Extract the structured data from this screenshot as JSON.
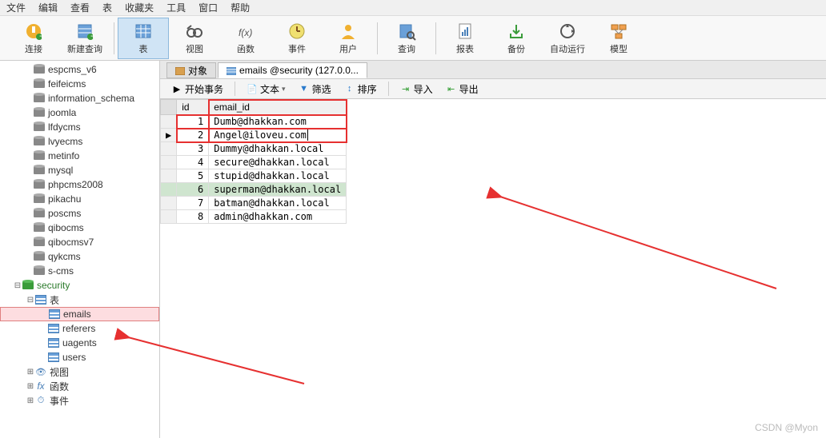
{
  "menu": {
    "items": [
      "文件",
      "编辑",
      "查看",
      "表",
      "收藏夹",
      "工具",
      "窗口",
      "帮助"
    ]
  },
  "toolbar": {
    "items": [
      {
        "label": "连接",
        "name": "connect-button",
        "icon": "plug",
        "dd": true
      },
      {
        "label": "新建查询",
        "name": "new-query-button",
        "icon": "query",
        "dd": false
      },
      {
        "label": "表",
        "name": "table-button",
        "icon": "table",
        "dd": true,
        "active": true
      },
      {
        "label": "视图",
        "name": "view-button",
        "icon": "view",
        "dd": false
      },
      {
        "label": "函数",
        "name": "function-button",
        "icon": "fx",
        "dd": false
      },
      {
        "label": "事件",
        "name": "event-button",
        "icon": "clock",
        "dd": false
      },
      {
        "label": "用户",
        "name": "user-button",
        "icon": "user",
        "dd": false
      },
      {
        "label": "查询",
        "name": "query2-button",
        "icon": "search",
        "dd": false
      },
      {
        "label": "报表",
        "name": "report-button",
        "icon": "report",
        "dd": false
      },
      {
        "label": "备份",
        "name": "backup-button",
        "icon": "backup",
        "dd": false
      },
      {
        "label": "自动运行",
        "name": "auto-run-button",
        "icon": "auto",
        "dd": false
      },
      {
        "label": "模型",
        "name": "model-button",
        "icon": "model",
        "dd": false
      }
    ]
  },
  "tree": {
    "databases": [
      "espcms_v6",
      "feifeicms",
      "information_schema",
      "joomla",
      "lfdycms",
      "lvyecms",
      "metinfo",
      "mysql",
      "phpcms2008",
      "pikachu",
      "poscms",
      "qibocms",
      "qibocmsv7",
      "qykcms",
      "s-cms"
    ],
    "active_db": "security",
    "groups": {
      "tables": {
        "label": "表",
        "children": [
          "emails",
          "referers",
          "uagents",
          "users"
        ]
      },
      "views": {
        "label": "视图"
      },
      "functions": {
        "label": "函数"
      },
      "events": {
        "label": "事件"
      }
    }
  },
  "tabs": {
    "obj": "对象",
    "current": "emails @security (127.0.0..."
  },
  "sub": {
    "begin": "开始事务",
    "text": "文本",
    "filter": "筛选",
    "sort": "排序",
    "import": "导入",
    "export": "导出"
  },
  "grid": {
    "columns": [
      "id",
      "email_id"
    ],
    "rows": [
      {
        "id": 1,
        "email_id": "Dumb@dhakkan.com"
      },
      {
        "id": 2,
        "email_id": "Angel@iloveu.com"
      },
      {
        "id": 3,
        "email_id": "Dummy@dhakkan.local"
      },
      {
        "id": 4,
        "email_id": "secure@dhakkan.local"
      },
      {
        "id": 5,
        "email_id": "stupid@dhakkan.local"
      },
      {
        "id": 6,
        "email_id": "superman@dhakkan.local"
      },
      {
        "id": 7,
        "email_id": "batman@dhakkan.local"
      },
      {
        "id": 8,
        "email_id": "admin@dhakkan.com"
      }
    ],
    "active_row": 2,
    "hl_row": 6
  },
  "watermark": "CSDN @Myon"
}
